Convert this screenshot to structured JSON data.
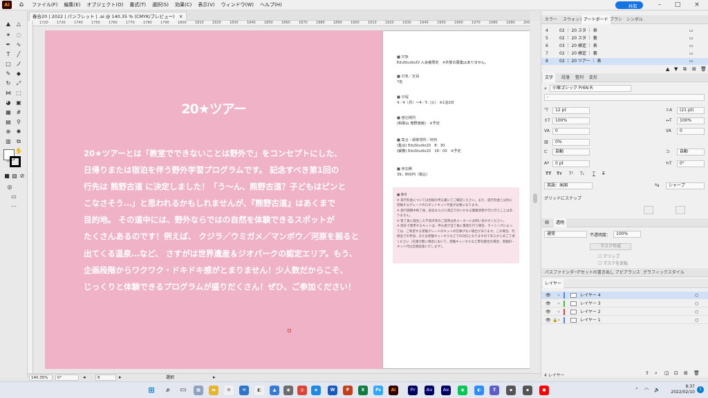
{
  "menubar": {
    "logo": "Ai",
    "items": [
      "ファイル(F)",
      "編集(E)",
      "オブジェクト(O)",
      "書式(T)",
      "選択(S)",
      "効果(C)",
      "表示(V)",
      "ウィンドウ(W)",
      "ヘルプ(H)"
    ],
    "share_label": "共有"
  },
  "document": {
    "tab_title": "春合20 | 2022 | パンフレット | .ai @ 140.35 % (CMYK/プレビュー)",
    "tab_close": "×"
  },
  "ruler": {
    "ticks": [
      "1720",
      "1730",
      "1740",
      "1750",
      "1760",
      "1770",
      "1780",
      "1790",
      "1800",
      "1810",
      "1820",
      "1830",
      "1840",
      "1850",
      "1860",
      "1870",
      "1880",
      "1890",
      "1900",
      "1910",
      "1920",
      "1930",
      "1940",
      "1950",
      "1960",
      "1970",
      "1980",
      "1990",
      "2000",
      "2010"
    ]
  },
  "artwork": {
    "logo": "20★ツアー",
    "body_lines": [
      "20★ツアーとは「教室でできないことは野外で」をコンセプトにした、",
      "日帰りまたは宿泊を伴う野外学習プログラムです。 記念すべき第1回の",
      "行先は 熊野古道 に決定しました！「う～ん、熊野古道？子どもはピンと",
      "こなさそう…」と思われるかもしれませんが、『熊野古道』はあくまで",
      "目的地。 その道中には、野外ならではの自然を体験できるスポットが",
      "たくさんあるのです！例えば、 クジラ／ウミガメ／マンボウ／河原を掘ると",
      "出てくる温泉…など、 さすがは世界遺産＆ジオパークの認定エリア。もう、",
      "企画段階からワクワク・ドキドキ感がとまりません！少人数だからこそ、",
      "じっくりと体験できるプログラムが盛りだくさん！ぜひ、ご参加ください！"
    ],
    "info": [
      {
        "head": "■ 対象",
        "body": [
          "EduStudio20 入会者限定　※外部の募集はありません。"
        ]
      },
      {
        "head": "■ 対象／定員",
        "body": [
          "7名"
        ]
      },
      {
        "head": "■ 日程",
        "body": [
          "4／4（月）～4／5（火） ※1泊2日"
        ]
      },
      {
        "head": "■ 宿泊場所",
        "body": [
          "(和歌山 熊野旅館)　※予定"
        ]
      },
      {
        "head": "■ 集合・解散場所／時刻",
        "body": [
          "(集合) EduStudio20　8：30",
          "(解散) EduStudio20　18：00　※予定"
        ]
      },
      {
        "head": "■ 参加費",
        "body": [
          "39，800円（税込）"
        ]
      }
    ],
    "notes": [
      "■ 備考",
      "※ 旅行料金については別紙の申込書にてご確認ください。また、旅行料金とは別に受験するグレードのロボットキット代金が必要になります。",
      "※ 旅行期間中終了後、宿舎ならびに周辺でのいかなる健康状態や行に行うことはありません。",
      "※ 緊了後に発生した不満点等のご質問は各メーカーにお問い合わせください。",
      "※ 雨天で使用するキットは、申込者が当て後に業者を行う場合、タイミングによっては、ご希望する受験グレードのキットの在庫がない場合があります。この場合、代替品での参加、または受験キャンセルなどでの対応となりますのであらかじめご了承ください（在庫が無い場合において、受験キャンセルなど弊社都合の場合、受験料・キット代は全額返金いたします）。"
    ]
  },
  "status": {
    "zoom": "140.35%",
    "rotate": "0°",
    "artboard": "8",
    "tool": "選択"
  },
  "artboards_panel": {
    "tabs": [
      "カラー",
      "スウォッチ",
      "アートボード",
      "ブラシ",
      "シンボル"
    ],
    "rows": [
      {
        "num": "4",
        "name": "02 ｜ 20 スタ ｜ 表"
      },
      {
        "num": "5",
        "name": "02 ｜ 20 スタ ｜ 裏"
      },
      {
        "num": "6",
        "name": "03 ｜ 20 検定 ｜ 表"
      },
      {
        "num": "7",
        "name": "02 ｜ 20 検定 ｜ 裏"
      },
      {
        "num": "8",
        "name": "02 ｜ 20 ツアー ｜ 表"
      }
    ]
  },
  "character_panel": {
    "tabs": [
      "文字",
      "段落",
      "整列",
      "変形"
    ],
    "font": "小塚ゴシック Pr6N R",
    "style": "-",
    "size": "12 pt",
    "leading": "(21 pt)",
    "vscale": "100%",
    "hscale": "100%",
    "kerning": "0",
    "tracking": "0",
    "tsume": "0%",
    "aki_left": "自動",
    "aki_right": "自動",
    "baseline": "0 pt",
    "rotation": "0°",
    "tt1": "TT",
    "tt2": "Tт",
    "lang": "英語：米国",
    "aa": "シャープ"
  },
  "snap_panel": {
    "label": "グリッドにスナップ"
  },
  "transparency_panel": {
    "tabs": [
      "線",
      "透明"
    ],
    "blend": "通常",
    "opacity_label": "不透明度：",
    "opacity": "100%",
    "mask_btn": "マスク作成",
    "clip": "クリップ",
    "invert": "マスクを反転"
  },
  "layers_panel": {
    "tabs": [
      "パスファインダー",
      "アセットの書き出し",
      "アピアランス",
      "グラフィックスタイル"
    ],
    "title": "レイヤー",
    "layers": [
      "レイヤー 4",
      "レイヤー 3",
      "レイヤー 2",
      "レイヤー 1"
    ],
    "colors": [
      "#4f86f7",
      "#3cc03c",
      "#e04040",
      "#4f86f7"
    ],
    "count": "4 レイヤー"
  },
  "taskbar": {
    "apps": [
      "Ai",
      "Ps",
      "Pr",
      "Au",
      "Ae",
      "W",
      "X",
      "P"
    ],
    "time": "8:37",
    "date": "2022/02/10"
  }
}
